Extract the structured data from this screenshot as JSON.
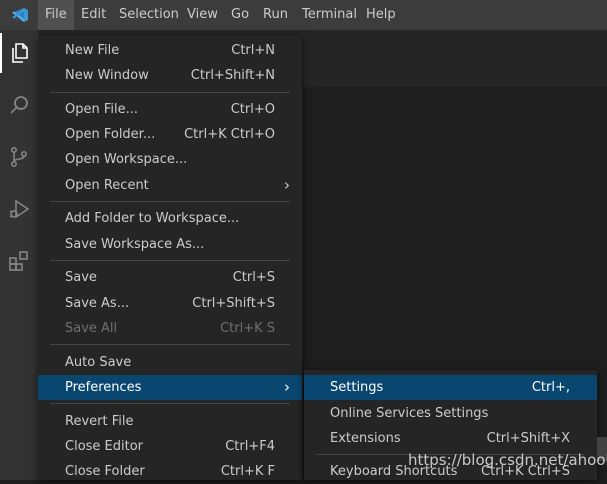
{
  "menubar": {
    "logo_icon": "vscode-logo-icon",
    "items": [
      "File",
      "Edit",
      "Selection",
      "View",
      "Go",
      "Run",
      "Terminal",
      "Help"
    ]
  },
  "activity_bar": {
    "icons": [
      "explorer-icon",
      "search-icon",
      "source-control-icon",
      "run-debug-icon",
      "extensions-icon"
    ]
  },
  "file_menu": {
    "new_file": {
      "label": "New File",
      "shortcut": "Ctrl+N"
    },
    "new_window": {
      "label": "New Window",
      "shortcut": "Ctrl+Shift+N"
    },
    "open_file": {
      "label": "Open File...",
      "shortcut": "Ctrl+O"
    },
    "open_folder": {
      "label": "Open Folder...",
      "shortcut": "Ctrl+K Ctrl+O"
    },
    "open_workspace": {
      "label": "Open Workspace..."
    },
    "open_recent": {
      "label": "Open Recent"
    },
    "add_folder": {
      "label": "Add Folder to Workspace..."
    },
    "save_workspace_as": {
      "label": "Save Workspace As..."
    },
    "save": {
      "label": "Save",
      "shortcut": "Ctrl+S"
    },
    "save_as": {
      "label": "Save As...",
      "shortcut": "Ctrl+Shift+S"
    },
    "save_all": {
      "label": "Save All",
      "shortcut": "Ctrl+K S"
    },
    "auto_save": {
      "label": "Auto Save"
    },
    "preferences": {
      "label": "Preferences"
    },
    "revert_file": {
      "label": "Revert File"
    },
    "close_editor": {
      "label": "Close Editor",
      "shortcut": "Ctrl+F4"
    },
    "close_folder": {
      "label": "Close Folder",
      "shortcut": "Ctrl+K F"
    }
  },
  "preferences_menu": {
    "settings": {
      "label": "Settings",
      "shortcut": "Ctrl+,"
    },
    "online_services": {
      "label": "Online Services Settings"
    },
    "extensions": {
      "label": "Extensions",
      "shortcut": "Ctrl+Shift+X"
    },
    "keyboard_shortcuts": {
      "label": "Keyboard Shortcuts",
      "shortcut": "Ctrl+K Ctrl+S"
    }
  },
  "watermark": "https://blog.csdn.net/ahook",
  "colors": {
    "menubar_bg": "#3c3c3c",
    "activity_bar_bg": "#333333",
    "menu_bg": "#252526",
    "highlight_bg": "#094771",
    "accent_blue": "#3c99d4"
  }
}
